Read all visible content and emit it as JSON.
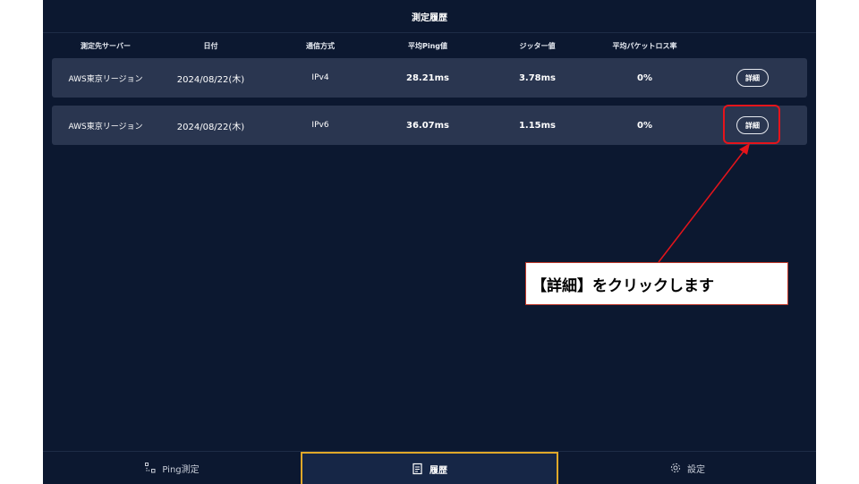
{
  "header": {
    "title": "測定履歴"
  },
  "columns": {
    "server": "測定先サーバー",
    "date": "日付",
    "protocol": "通信方式",
    "ping": "平均Ping値",
    "jitter": "ジッター値",
    "loss": "平均パケットロス率"
  },
  "rows": [
    {
      "server": "AWS東京リージョン",
      "date": "2024/08/22(木)",
      "protocol": "IPv4",
      "ping": "28.21ms",
      "jitter": "3.78ms",
      "loss": "0%",
      "action": "詳細"
    },
    {
      "server": "AWS東京リージョン",
      "date": "2024/08/22(木)",
      "protocol": "IPv6",
      "ping": "36.07ms",
      "jitter": "1.15ms",
      "loss": "0%",
      "action": "詳細"
    }
  ],
  "nav": {
    "ping": {
      "label": "Ping測定",
      "icon": "ping-icon"
    },
    "history": {
      "label": "履歴",
      "icon": "history-icon"
    },
    "settings": {
      "label": "設定",
      "icon": "gear-icon"
    }
  },
  "annotation": {
    "text": "【詳細】をクリックします"
  },
  "colors": {
    "background": "#0c1830",
    "row": "#2a3650",
    "active_tab_border": "#e0a829",
    "annotation_red": "#e5141b"
  }
}
